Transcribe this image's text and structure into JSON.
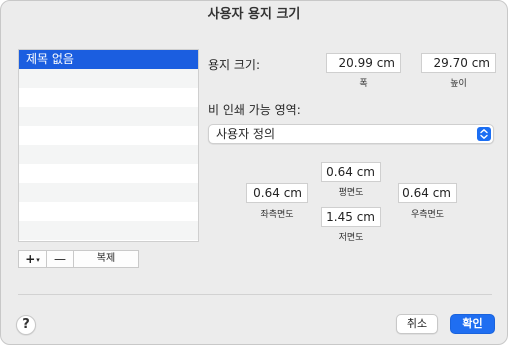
{
  "window": {
    "title": "사용자 용지 크기"
  },
  "paper_list": {
    "items": [
      {
        "label": "제목 없음",
        "selected": true
      }
    ],
    "empty_rows": 9
  },
  "list_toolbar": {
    "add_label": "+",
    "add_caret": "▾",
    "remove_label": "—",
    "duplicate_label": "복제"
  },
  "paper_size": {
    "label": "용지 크기:",
    "width_value": "20.99 cm",
    "width_caption": "폭",
    "height_value": "29.70 cm",
    "height_caption": "높이"
  },
  "non_printable": {
    "label": "비 인쇄 가능 영역:",
    "select_value": "사용자 정의",
    "select_icon": "up-down-chevron-icon",
    "accent": "#1b6ef3"
  },
  "margins": {
    "top_value": "0.64 cm",
    "top_caption": "평면도",
    "left_value": "0.64 cm",
    "left_caption": "좌측면도",
    "right_value": "0.64 cm",
    "right_caption": "우측면도",
    "bottom_value": "1.45 cm",
    "bottom_caption": "저면도"
  },
  "footer": {
    "help_label": "?",
    "cancel_label": "취소",
    "ok_label": "확인"
  }
}
